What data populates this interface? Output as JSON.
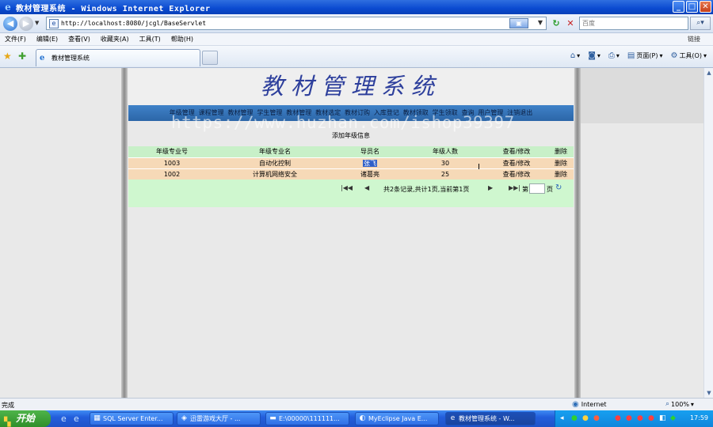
{
  "window": {
    "title": "教材管理系统 - Windows Internet Explorer",
    "minimize": "_",
    "maximize": "□",
    "close": "✕"
  },
  "address": {
    "url": "http://localhost:8080/jcgl/BaseServlet",
    "search_placeholder": "百度"
  },
  "menu": {
    "items": [
      "文件(F)",
      "编辑(E)",
      "查看(V)",
      "收藏夹(A)",
      "工具(T)",
      "帮助(H)"
    ],
    "links_label": "链接"
  },
  "tabs": {
    "active_tab": "教材管理系统",
    "page_label": "页面(P)",
    "tools_label": "工具(O)"
  },
  "app": {
    "title": "教材管理系统",
    "nav": [
      "年级管理",
      "课程管理",
      "教材管理",
      "学生管理",
      "教材管理",
      "教材选定",
      "教材订购",
      "入库登记",
      "教材领取",
      "学生领取",
      "查询",
      "用户管理",
      "注销退出"
    ],
    "add_link": "添加年级信息",
    "table": {
      "headers": [
        "年级专业号",
        "年级专业名",
        "导员名",
        "年级人数",
        "查看/修改",
        "删除"
      ],
      "rows": [
        [
          "1003",
          "自动化控制",
          "张飞",
          "30",
          "查看/修改",
          "删除"
        ],
        [
          "1002",
          "计算机网络安全",
          "诸葛亮",
          "25",
          "查看/修改",
          "删除"
        ]
      ]
    },
    "pager": {
      "info": "共2条记录,共计1页,当前第1页",
      "page_prefix": "第",
      "page_suffix": "页"
    }
  },
  "watermark": "https://www.huzhan.com/ishop39397",
  "status": {
    "text": "完成",
    "zone": "Internet",
    "zoom": "100%"
  },
  "taskbar": {
    "start": "开始",
    "tasks": [
      "SQL Server Enter...",
      "迅雷游戏大厅 - ...",
      "E:\\00000\\111111...",
      "MyEclipse Java E...",
      "教材管理系统 - W..."
    ],
    "clock": "17:59"
  }
}
